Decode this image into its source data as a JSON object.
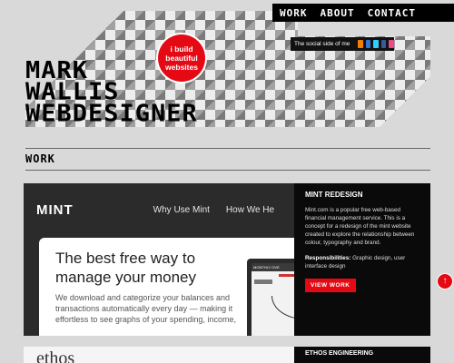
{
  "nav": {
    "items": [
      "WORK",
      "ABOUT",
      "CONTACT"
    ]
  },
  "social": {
    "label": "The social side of me",
    "icons": [
      "blogger-icon",
      "delicious-icon",
      "twitter-icon",
      "facebook-icon",
      "dribbble-icon"
    ]
  },
  "badge": {
    "line1": "i build",
    "line2": "beautiful",
    "line3": "websites"
  },
  "logo": {
    "line1": "MARK",
    "line2": "WALLIS",
    "line3": "WEBDESIGNER"
  },
  "section": {
    "title": "WORK"
  },
  "work_item": {
    "shot": {
      "brand": "MINT",
      "nav": [
        "Why Use Mint",
        "How We He"
      ],
      "headline": "The best free way to manage your money",
      "body": "We download and categorize your balances and transactions automatically every day — making it effortless to see graphs of your spending, income,",
      "phone_header": "MONTHLY OVE"
    },
    "title": "MINT REDESIGN",
    "description": "Mint.com is a popular free web-based financial management service. This is a concept for a redesign of the mint website created to explore the relationship between colour, typography and brand.",
    "responsibilities_label": "Responsibilities:",
    "responsibilities": "Graphic design, user interface design",
    "button": "VIEW WORK"
  },
  "next_item": {
    "shot_text": "ethos",
    "title": "ETHOS ENGINEERING"
  },
  "scroll_top": "↑",
  "colors": {
    "accent": "#e50914",
    "background": "#d9d9d9",
    "dark": "#0a0a0a"
  }
}
